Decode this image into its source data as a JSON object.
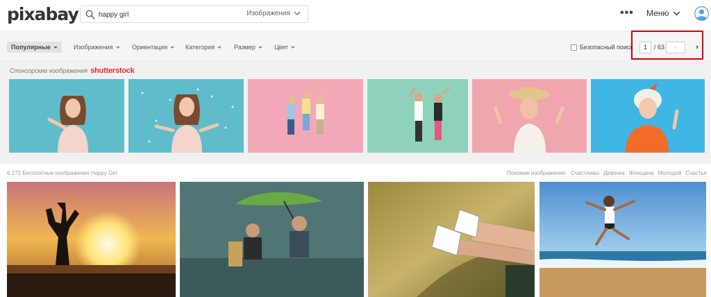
{
  "header": {
    "logo": "pixabay",
    "search_value": "happy girl",
    "search_scope": "Изображения",
    "menu_label": "Меню",
    "more_glyph": "•••"
  },
  "filters": {
    "popular": "Популярные",
    "items": [
      "Изображения",
      "Ориентация",
      "Категория",
      "Размер",
      "Цвет"
    ],
    "safe_search": "Безопасный поиск"
  },
  "pagination": {
    "current": "1",
    "total": "/ 63",
    "prev_glyph": "‹",
    "next_glyph": "›"
  },
  "sponsored": {
    "label": "Спонсорские изображения",
    "brand": "shutterstock"
  },
  "results": {
    "count_text": "6 272 Бесплатные изображения Happy Girl",
    "related_label": "Похожие изображения:",
    "related_tags": [
      "Счастливы",
      "Девочка",
      "Женщина",
      "Молодой",
      "Счастье"
    ]
  },
  "colors": {
    "accent_red": "#d40000",
    "shutterstock": "#ee2b24",
    "avatar_blue": "#5a9fe0"
  }
}
